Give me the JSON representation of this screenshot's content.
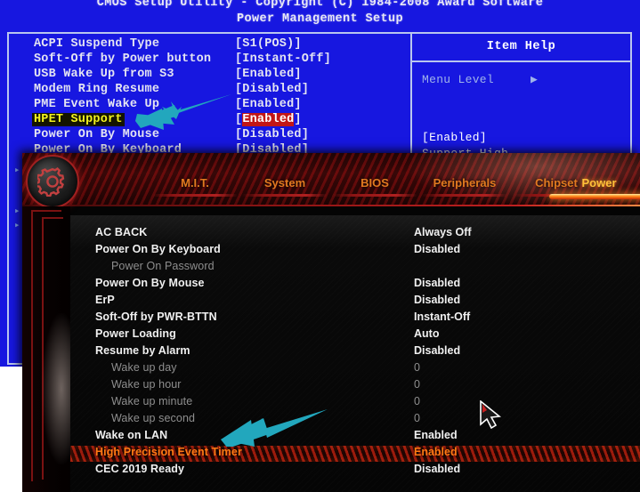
{
  "legacy_bios": {
    "title_line1": "CMOS Setup Utility - Copyright (C) 1984-2008 Award Software",
    "title_line2": "Power Management Setup",
    "help_header": "Item Help",
    "help_menu_level": "Menu Level",
    "help_value": "[Enabled]",
    "help_desc": "Support High",
    "nav_hint": "↑↓",
    "rows": [
      {
        "name": "ACPI Suspend Type",
        "value": "[S1(POS)]",
        "selected": false
      },
      {
        "name": "Soft-Off by Power button",
        "value": "[Instant-Off]",
        "selected": false
      },
      {
        "name": "USB Wake Up from S3",
        "value": "[Enabled]",
        "selected": false
      },
      {
        "name": "Modem Ring Resume",
        "value": "[Disabled]",
        "selected": false
      },
      {
        "name": "PME Event Wake Up",
        "value": "[Enabled]",
        "selected": false
      },
      {
        "name": "HPET Support",
        "value": "Enabled",
        "selected": true
      },
      {
        "name": "Power On By Mouse",
        "value": "[Disabled]",
        "selected": false
      },
      {
        "name": "Power On By Keyboard",
        "value": "[Disabled]",
        "selected": false
      }
    ]
  },
  "uefi": {
    "logo_icon": "gear-icon",
    "tabs": [
      {
        "label": "M.I.T.",
        "active": false
      },
      {
        "label": "System",
        "active": false
      },
      {
        "label": "BIOS",
        "active": false
      },
      {
        "label": "Peripherals",
        "active": false
      },
      {
        "label": "Chipset",
        "active": false
      },
      {
        "label": "Power",
        "active": true
      }
    ],
    "settings": [
      {
        "name": "AC BACK",
        "value": "Always Off",
        "sub": false,
        "highlighted": false
      },
      {
        "name": "Power On By Keyboard",
        "value": "Disabled",
        "sub": false,
        "highlighted": false
      },
      {
        "name": "Power On Password",
        "value": "",
        "sub": true,
        "highlighted": false
      },
      {
        "name": "Power On By Mouse",
        "value": "Disabled",
        "sub": false,
        "highlighted": false
      },
      {
        "name": "ErP",
        "value": "Disabled",
        "sub": false,
        "highlighted": false
      },
      {
        "name": "Soft-Off by PWR-BTTN",
        "value": "Instant-Off",
        "sub": false,
        "highlighted": false
      },
      {
        "name": "Power Loading",
        "value": "Auto",
        "sub": false,
        "highlighted": false
      },
      {
        "name": "Resume by Alarm",
        "value": "Disabled",
        "sub": false,
        "highlighted": false
      },
      {
        "name": "Wake up day",
        "value": "0",
        "sub": true,
        "highlighted": false
      },
      {
        "name": "Wake up hour",
        "value": "0",
        "sub": true,
        "highlighted": false
      },
      {
        "name": "Wake up minute",
        "value": "0",
        "sub": true,
        "highlighted": false
      },
      {
        "name": "Wake up second",
        "value": "0",
        "sub": true,
        "highlighted": false
      },
      {
        "name": "Wake on LAN",
        "value": "Enabled",
        "sub": false,
        "highlighted": false
      },
      {
        "name": "High Precision Event Timer",
        "value": "Enabled",
        "sub": false,
        "highlighted": true
      },
      {
        "name": "CEC 2019 Ready",
        "value": "Disabled",
        "sub": false,
        "highlighted": false
      }
    ],
    "cursor_icon": "mouse-pointer-icon"
  },
  "annotations": [
    {
      "name": "arrow-pointing-to-hpet-support",
      "color": "#22a7bd"
    },
    {
      "name": "arrow-pointing-to-high-precision-event-timer",
      "color": "#22a7bd"
    }
  ],
  "colors": {
    "legacy_bg": "#1717e0",
    "legacy_border": "#b9c6ee",
    "legacy_selected_text": "#f2f21e",
    "legacy_value_highlight": "#c21616",
    "uefi_bg": "#040404",
    "uefi_tab": "#e07a20",
    "uefi_tab_active": "#ffc23a",
    "uefi_highlight_text": "#ff7a14",
    "annotation_arrow": "#22a7bd"
  }
}
